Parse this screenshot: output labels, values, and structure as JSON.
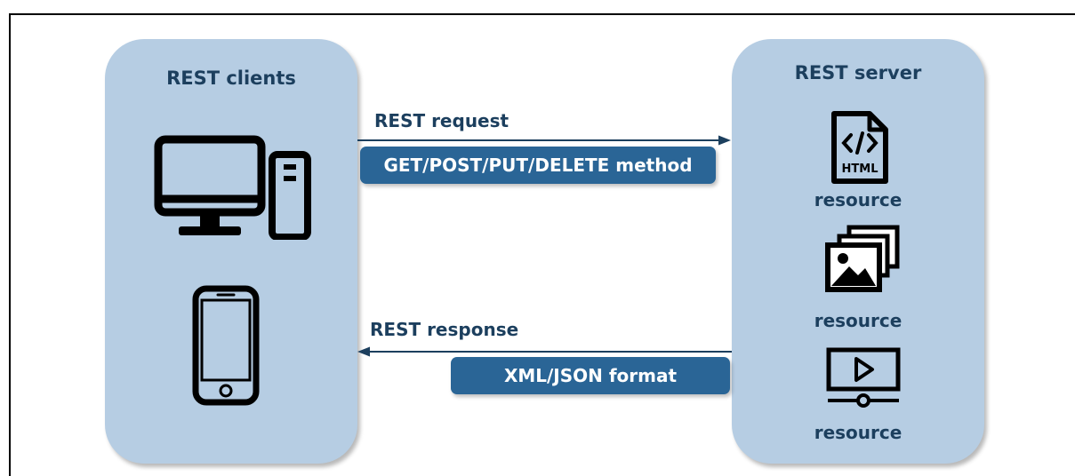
{
  "clients_panel": {
    "title": "REST clients"
  },
  "server_panel": {
    "title": "REST server",
    "resources": [
      {
        "icon": "html-file-icon",
        "label": "resource",
        "icon_text": "HTML"
      },
      {
        "icon": "image-stack-icon",
        "label": "resource"
      },
      {
        "icon": "video-player-icon",
        "label": "resource"
      }
    ]
  },
  "request": {
    "label": "REST request",
    "method": "GET/POST/PUT/DELETE method"
  },
  "response": {
    "label": "REST response",
    "format": "XML/JSON format"
  },
  "colors": {
    "panel": "#b6cde3",
    "pill": "#2a6596",
    "text": "#1c3f5e",
    "arrow": "#1c3f5e"
  }
}
